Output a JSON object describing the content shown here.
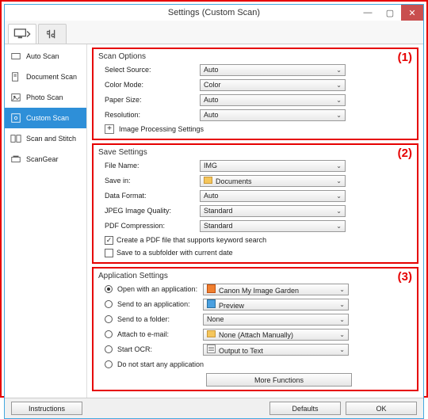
{
  "title": "Settings (Custom Scan)",
  "sidebar": {
    "items": [
      {
        "label": "Auto Scan"
      },
      {
        "label": "Document Scan"
      },
      {
        "label": "Photo Scan"
      },
      {
        "label": "Custom Scan"
      },
      {
        "label": "Scan and Stitch"
      },
      {
        "label": "ScanGear"
      }
    ]
  },
  "callouts": {
    "g1": "(1)",
    "g2": "(2)",
    "g3": "(3)"
  },
  "scanOptions": {
    "title": "Scan Options",
    "selectSourceLabel": "Select Source:",
    "selectSourceValue": "Auto",
    "colorModeLabel": "Color Mode:",
    "colorModeValue": "Color",
    "paperSizeLabel": "Paper Size:",
    "paperSizeValue": "Auto",
    "resolutionLabel": "Resolution:",
    "resolutionValue": "Auto",
    "imageProcessing": "Image Processing Settings"
  },
  "saveSettings": {
    "title": "Save Settings",
    "fileNameLabel": "File Name:",
    "fileNameValue": "IMG",
    "saveInLabel": "Save in:",
    "saveInValue": "Documents",
    "dataFormatLabel": "Data Format:",
    "dataFormatValue": "Auto",
    "jpegQualityLabel": "JPEG Image Quality:",
    "jpegQualityValue": "Standard",
    "pdfCompLabel": "PDF Compression:",
    "pdfCompValue": "Standard",
    "pdfKeyword": "Create a PDF file that supports keyword search",
    "subfolder": "Save to a subfolder with current date"
  },
  "appSettings": {
    "title": "Application Settings",
    "openWithLabel": "Open with an application:",
    "openWithValue": "Canon My Image Garden",
    "sendAppLabel": "Send to an application:",
    "sendAppValue": "Preview",
    "sendFolderLabel": "Send to a folder:",
    "sendFolderValue": "None",
    "attachLabel": "Attach to e-mail:",
    "attachValue": "None (Attach Manually)",
    "ocrLabel": "Start OCR:",
    "ocrValue": "Output to Text",
    "noneLabel": "Do not start any application",
    "moreFunctions": "More Functions"
  },
  "footer": {
    "instructions": "Instructions",
    "defaults": "Defaults",
    "ok": "OK"
  }
}
